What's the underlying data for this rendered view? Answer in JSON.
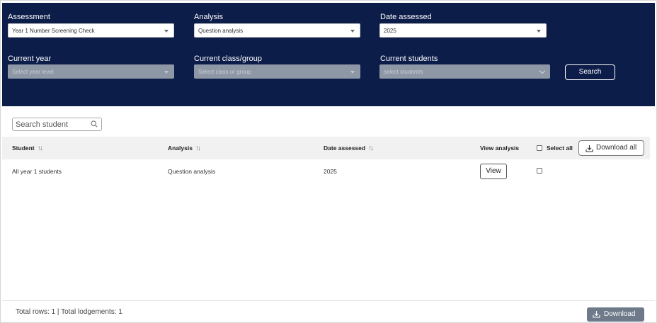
{
  "filters": {
    "assessment": {
      "label": "Assessment",
      "value": "Year 1 Number Screening Check"
    },
    "analysis": {
      "label": "Analysis",
      "value": "Question analysis"
    },
    "date_assessed": {
      "label": "Date assessed",
      "value": "2025"
    },
    "current_year": {
      "label": "Current year",
      "placeholder": "Select year level"
    },
    "current_class": {
      "label": "Current class/group",
      "placeholder": "Select class or group"
    },
    "current_students": {
      "label": "Current students",
      "placeholder": "select student/s"
    },
    "search_button": "Search"
  },
  "search_student": {
    "placeholder": "Search student"
  },
  "table": {
    "columns": {
      "student": "Student",
      "analysis": "Analysis",
      "date_assessed": "Date assessed",
      "view_analysis": "View analysis",
      "select_all": "Select all"
    },
    "download_all": "Download all",
    "rows": [
      {
        "student": "All year 1 students",
        "analysis": "Question analysis",
        "date_assessed": "2025",
        "view_label": "View"
      }
    ]
  },
  "footer": {
    "totals": "Total rows: 1 | Total lodgements: 1",
    "download": "Download"
  },
  "colors": {
    "panel_bg": "#0d1d4a",
    "disabled_select": "#8e97a5",
    "download_button": "#6e7a8a"
  },
  "icons": [
    "chevron-down-icon",
    "search-icon",
    "sort-icon",
    "download-icon"
  ]
}
